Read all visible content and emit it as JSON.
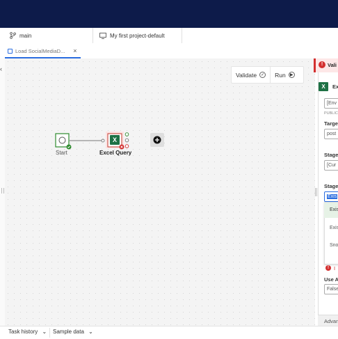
{
  "branch": {
    "name": "main"
  },
  "project": {
    "name": "My first project-default"
  },
  "tab": {
    "label": "Load SocialMediaD...",
    "close": "×"
  },
  "toolbar": {
    "validate_label": "Validate",
    "run_label": "Run"
  },
  "flow": {
    "start_label": "Start",
    "excel_label": "Excel Query",
    "add_symbol": "+"
  },
  "right_panel": {
    "error_banner": "Vali",
    "node_title": "Exc",
    "field_env_value": "[Env",
    "public_label": "PUBLIC",
    "target_label": "Targe",
    "target_value": "post",
    "stage1_label": "Stage",
    "stage1_value": "[Cur",
    "stage2_label": "Stage",
    "stage2_value": "Exis",
    "dropdown_options": [
      "Exis",
      "Exis",
      "Sno"
    ],
    "error_text": "I",
    "use_label": "Use A",
    "use_value": "False",
    "advanced_label": "Advan"
  },
  "bottom": {
    "task_history": "Task history",
    "sample_data": "Sample data"
  },
  "icons": {
    "branch": "branch-icon",
    "project": "project-icon",
    "tab": "dataflow-icon",
    "collapse": "chevron-left-icon",
    "validate": "check-circle-icon",
    "run": "play-circle-icon",
    "error": "error-icon",
    "excel": "excel-icon"
  },
  "colors": {
    "topbar": "#0d1b4a",
    "accent": "#2a6de0",
    "error": "#d32f2f",
    "success": "#2e8b2e",
    "excel": "#1e7145"
  }
}
